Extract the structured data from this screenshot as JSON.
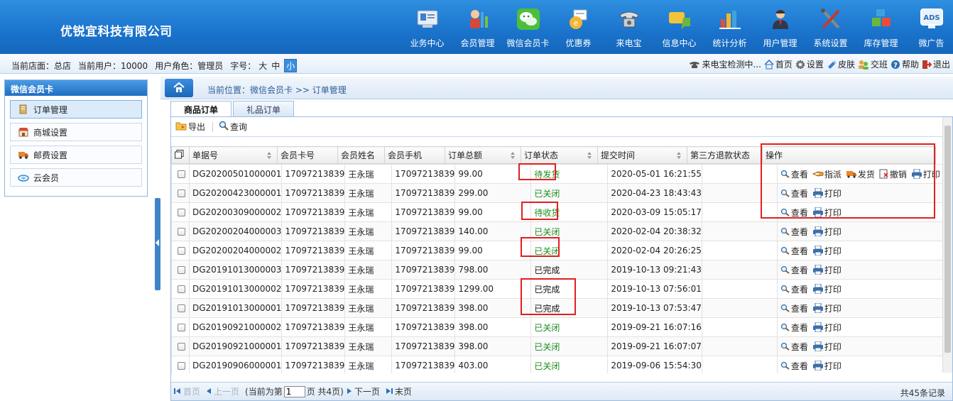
{
  "app": {
    "company": "优锐宜科技有限公司"
  },
  "nav": [
    {
      "label": "业务中心",
      "icon": "business-center-icon"
    },
    {
      "label": "会员管理",
      "icon": "member-management-icon"
    },
    {
      "label": "微信会员卡",
      "icon": "wechat-card-icon"
    },
    {
      "label": "优惠券",
      "icon": "coupon-icon"
    },
    {
      "label": "来电宝",
      "icon": "phone-icon"
    },
    {
      "label": "信息中心",
      "icon": "message-center-icon"
    },
    {
      "label": "统计分析",
      "icon": "statistics-icon"
    },
    {
      "label": "用户管理",
      "icon": "user-management-icon"
    },
    {
      "label": "系统设置",
      "icon": "tools-icon"
    },
    {
      "label": "库存管理",
      "icon": "inventory-icon"
    },
    {
      "label": "微广告",
      "icon": "ads-icon"
    }
  ],
  "infobar": {
    "store": "当前店面：总店",
    "user": "当前用户：10000",
    "role": "用户角色：管理员",
    "font_label": "字号：",
    "font_sizes": [
      "大",
      "中",
      "小"
    ],
    "right": [
      {
        "label": "来电宝检测中...",
        "icon": "phone-icon"
      },
      {
        "label": "首页",
        "icon": "home-icon"
      },
      {
        "label": "设置",
        "icon": "gear-icon"
      },
      {
        "label": "皮肤",
        "icon": "skin-icon"
      },
      {
        "label": "交班",
        "icon": "shift-icon"
      },
      {
        "label": "帮助",
        "icon": "help-icon"
      },
      {
        "label": "退出",
        "icon": "logout-icon"
      }
    ]
  },
  "sidebar": {
    "title": "微信会员卡",
    "items": [
      {
        "label": "订单管理"
      },
      {
        "label": "商城设置"
      },
      {
        "label": "邮费设置"
      },
      {
        "label": "云会员"
      }
    ]
  },
  "breadcrumb": "当前位置：微信会员卡 >> 订单管理",
  "tabs": [
    {
      "label": "商品订单"
    },
    {
      "label": "礼品订单"
    }
  ],
  "toolbar": {
    "export": "导出",
    "query": "查询"
  },
  "table": {
    "headers": [
      "单据号",
      "会员卡号",
      "会员姓名",
      "会员手机",
      "订单总额",
      "订单状态",
      "提交时间",
      "第三方退款状态",
      "操作"
    ],
    "ops": {
      "view": "查看",
      "assign": "指派",
      "ship": "发货",
      "cancel": "撤销",
      "print": "打印"
    },
    "rows": [
      [
        "DG20200501000001",
        "17097213839",
        "王永瑞",
        "17097213839",
        "99.00",
        "待发货",
        "2020-05-01 16:21:55",
        ""
      ],
      [
        "DG20200423000001",
        "17097213839",
        "王永瑞",
        "17097213839",
        "299.00",
        "已关闭",
        "2020-04-23 18:43:43",
        ""
      ],
      [
        "DG20200309000002",
        "17097213839",
        "王永瑞",
        "17097213839",
        "99.00",
        "待收货",
        "2020-03-09 15:05:17",
        ""
      ],
      [
        "DG20200204000003",
        "17097213839",
        "王永瑞",
        "17097213839",
        "140.00",
        "已关闭",
        "2020-02-04 20:38:32",
        ""
      ],
      [
        "DG20200204000002",
        "17097213839",
        "王永瑞",
        "17097213839",
        "99.00",
        "已关闭",
        "2020-02-04 20:26:25",
        ""
      ],
      [
        "DG20191013000003",
        "17097213839",
        "王永瑞",
        "17097213839",
        "798.00",
        "已完成",
        "2019-10-13 09:21:43",
        ""
      ],
      [
        "DG20191013000002",
        "17097213839",
        "王永瑞",
        "17097213839",
        "1299.00",
        "已完成",
        "2019-10-13 07:56:01",
        ""
      ],
      [
        "DG20191013000001",
        "17097213839",
        "王永瑞",
        "17097213839",
        "398.00",
        "已完成",
        "2019-10-13 07:53:47",
        ""
      ],
      [
        "DG20190921000002",
        "17097213839",
        "王永瑞",
        "17097213839",
        "398.00",
        "已关闭",
        "2019-09-21 16:07:16",
        ""
      ],
      [
        "DG20190921000001",
        "17097213839",
        "王永瑞",
        "17097213839",
        "398.00",
        "已关闭",
        "2019-09-21 16:07:07",
        ""
      ],
      [
        "DG20190906000001",
        "17097213839",
        "王永瑞",
        "17097213839",
        "403.00",
        "已关闭",
        "2019-09-06 15:54:30",
        ""
      ]
    ]
  },
  "pager": {
    "first": "首页",
    "prev": "上一页",
    "current_prefix": "(当前为第",
    "current_page": "1",
    "current_suffix": "页 共4页)",
    "next": "下一页",
    "last": "末页",
    "total": "共45条记录"
  }
}
